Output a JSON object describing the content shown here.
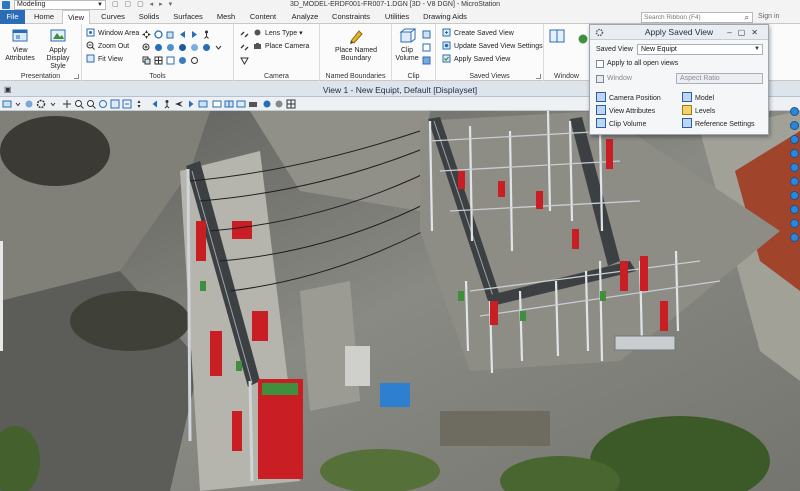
{
  "titlebar": {
    "workspace": "Modeling",
    "window_title": "3D_MODEL-ERDF001-FR007-1.DGN [3D - V8 DGN] - MicroStation"
  },
  "tabs": [
    "File",
    "Home",
    "View",
    "Curves",
    "Solids",
    "Surfaces",
    "Mesh",
    "Content",
    "Analyze",
    "Constraints",
    "Utilities",
    "Drawing Aids"
  ],
  "active_tab": "View",
  "search": {
    "placeholder": "Search Ribbon (F4)"
  },
  "signin": "Sign in",
  "ribbon": {
    "presentation": {
      "label": "Presentation",
      "view_attributes": "View Attributes",
      "apply_display_style": "Apply Display Style"
    },
    "tools": {
      "label": "Tools",
      "window_area": "Window Area",
      "zoom_out": "Zoom Out",
      "fit_view": "Fit View"
    },
    "camera": {
      "label": "Camera",
      "lens_type": "Lens Type",
      "place_camera": "Place Camera"
    },
    "named_boundaries": {
      "label": "Named Boundaries",
      "place_named_boundary": "Place Named Boundary"
    },
    "clip": {
      "label": "Clip",
      "clip_volume": "Clip Volume"
    },
    "saved_views": {
      "label": "Saved Views",
      "create_saved_view": "Create Saved View",
      "update_saved_view_settings": "Update Saved View Settings",
      "apply_saved_view": "Apply Saved View"
    },
    "window": {
      "label": "Window"
    }
  },
  "view": {
    "title": "View 1 - New Equipt, Default [Displayset]"
  },
  "dialog": {
    "title": "Apply Saved View",
    "saved_view_label": "Saved View",
    "saved_view_value": "New Equipt",
    "apply_all_label": "Apply to all open views",
    "window_label": "Window",
    "window_value": "Aspect Ratio",
    "options": {
      "camera_position": "Camera Position",
      "view_attributes": "View Attributes",
      "clip_volume": "Clip Volume",
      "model": "Model",
      "levels": "Levels",
      "reference_settings": "Reference Settings"
    }
  },
  "colors": {
    "file_tab": "#2a6db5",
    "accent": "#2f86d8",
    "equipment_red": "#c81e24",
    "equipment_green": "#3f8f3c",
    "steel": "#9aa4ab"
  }
}
